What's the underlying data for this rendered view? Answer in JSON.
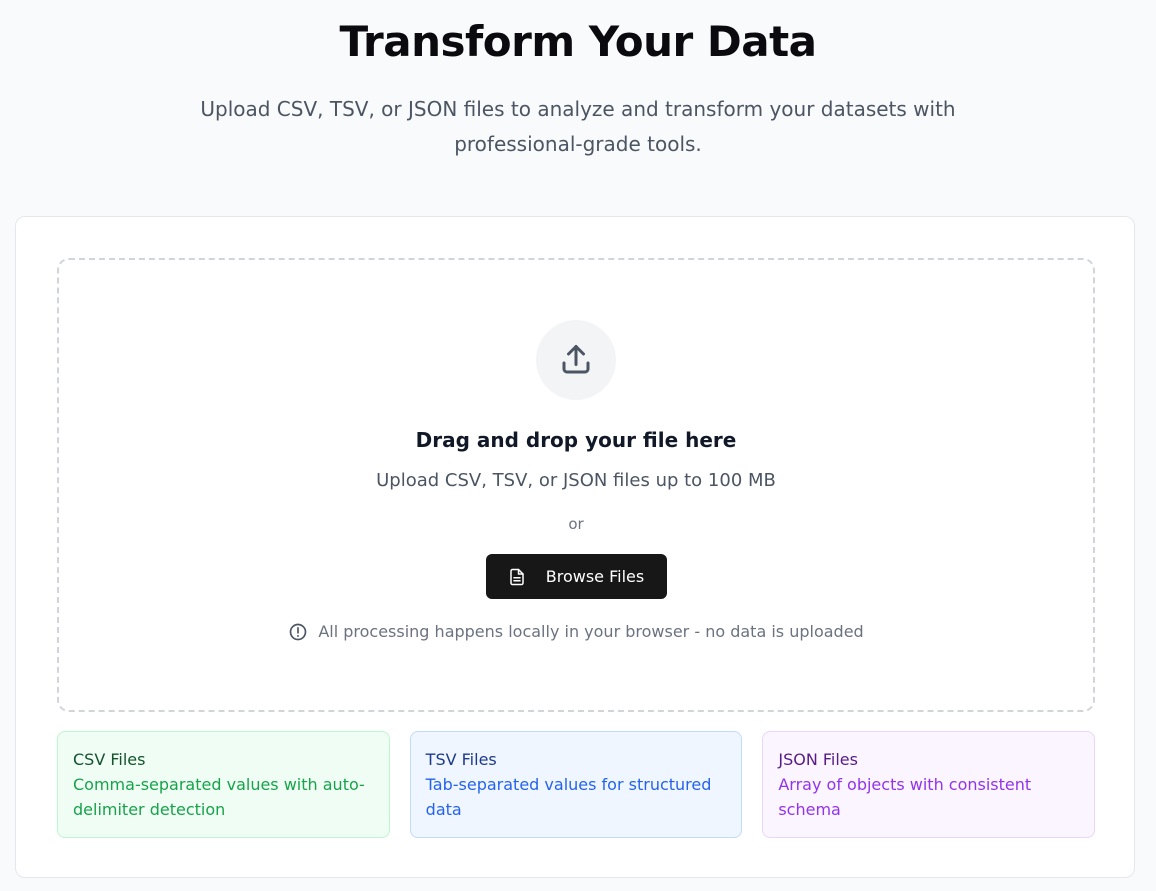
{
  "hero": {
    "title": "Transform Your Data",
    "subtitle": "Upload CSV, TSV, or JSON files to analyze and transform your datasets with professional-grade tools."
  },
  "dropzone": {
    "icon": "upload-icon",
    "title": "Drag and drop your file here",
    "subtitle": "Upload CSV, TSV, or JSON files up to 100 MB",
    "or_label": "or",
    "browse_label": "Browse Files",
    "browse_icon": "file-icon",
    "privacy_note": "All processing happens locally in your browser - no data is uploaded",
    "privacy_icon": "info-icon"
  },
  "file_types": [
    {
      "title": "CSV Files",
      "description": "Comma-separated values with auto-delimiter detection",
      "color": "#16a34a"
    },
    {
      "title": "TSV Files",
      "description": "Tab-separated values for structured data",
      "color": "#2563eb"
    },
    {
      "title": "JSON Files",
      "description": "Array of objects with consistent schema",
      "color": "#9333ea"
    }
  ]
}
